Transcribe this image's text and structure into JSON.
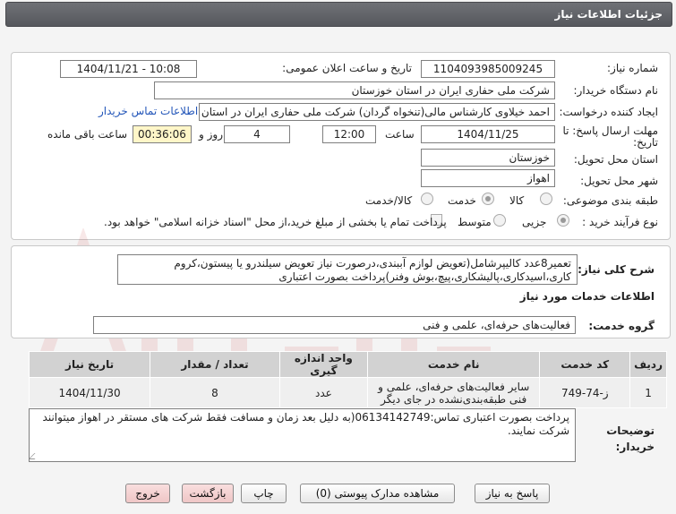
{
  "window": {
    "title": "جزئیات اطلاعات نیاز"
  },
  "form": {
    "need_number_label": "شماره نیاز:",
    "need_number": "1104093985009245",
    "announce_label": "تاریخ و ساعت اعلان عمومی:",
    "announce_value": "1404/11/21 - 10:08",
    "buyer_org_label": "نام دستگاه خریدار:",
    "buyer_org": "شرکت ملی حفاری ایران در استان خوزستان",
    "requester_label": "ایجاد کننده درخواست:",
    "requester": "احمد خیلاوی کارشناس مالی(تنخواه گردان) شرکت ملی حفاری ایران در استان",
    "contact_link": "اطلاعات تماس خریدار",
    "deadline_label_1": "مهلت ارسال پاسخ: تا",
    "deadline_label_2": "تاریخ:",
    "deadline_date": "1404/11/25",
    "time_label": "ساعت",
    "deadline_time": "12:00",
    "days_value": "4",
    "days_label": "روز و",
    "remaining_time": "00:36:06",
    "remaining_label": "ساعت باقی مانده",
    "province_label": "استان محل تحویل:",
    "province": "خوزستان",
    "city_label": "شهر محل تحویل:",
    "city": "اهواز",
    "category_label": "طبقه بندی موضوعی:",
    "category_options": [
      {
        "label": "کالا",
        "selected": false
      },
      {
        "label": "خدمت",
        "selected": true
      },
      {
        "label": "کالا/خدمت",
        "selected": false
      }
    ],
    "process_label": "نوع فرآیند خرید :",
    "process_options": [
      {
        "label": "جزیی",
        "selected": true
      },
      {
        "label": "متوسط",
        "selected": false
      }
    ],
    "payment_note": "پرداخت تمام یا بخشی از مبلغ خرید،از محل \"اسناد خزانه اسلامی\" خواهد بود."
  },
  "need": {
    "summary_label": "شرح کلی نیاز:",
    "summary_text": "تعمیر8عدد کالیپرشامل(تعویض لوازم آببندی،درصورت نیاز تعویض سیلندرو یا پیستون،کروم کاری،اسیدکاری،پالیشکاری،پیچ،بوش وفنر)پرداخت بصورت اعتباری",
    "services_heading": "اطلاعات خدمات مورد نیاز",
    "group_label": "گروه خدمت:",
    "group_value": "فعالیت‌های حرفه‌ای، علمی و فنی"
  },
  "table": {
    "headers": [
      "ردیف",
      "کد خدمت",
      "نام خدمت",
      "واحد اندازه گیری",
      "تعداد / مقدار",
      "تاریخ نیاز"
    ],
    "rows": [
      [
        "1",
        "ز-74-749",
        "سایر فعالیت‌های حرفه‌ای، علمی و فنی طبقه‌بندی‌نشده در جای دیگر",
        "عدد",
        "8",
        "1404/11/30"
      ]
    ]
  },
  "notes": {
    "label": "توضیحات خریدار:",
    "text": "پرداخت بصورت اعتباری تماس:06134142749(به دلیل بعد زمان و مسافت فقط شرکت های مستقر در اهواز میتوانند شرکت نمایند."
  },
  "buttons": {
    "reply": "پاسخ به نیاز",
    "attachments": "مشاهده مدارک پیوستی (0)",
    "print": "چاپ",
    "back": "بازگشت",
    "exit": "خروج"
  },
  "colors": {
    "titlebar": "#5f6166",
    "highlight_field": "#fff6c8",
    "link": "#2356b9",
    "exit_button": "#efc6c6"
  }
}
